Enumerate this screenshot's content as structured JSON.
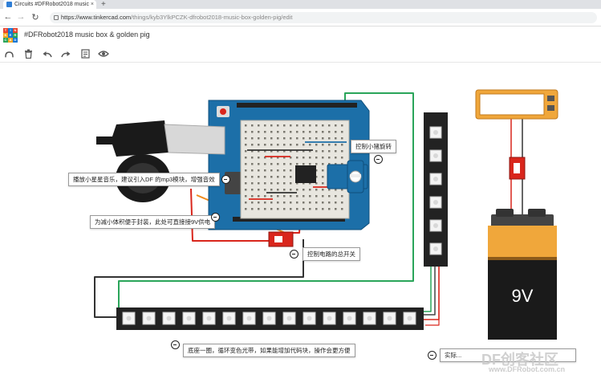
{
  "browser": {
    "tab_title": "Circuits #DFRobot2018 music",
    "tab_close": "×",
    "new_tab": "+",
    "url_main": "https://www.tinkercad.com",
    "url_path": "/things/kyb3YlkPCZK-dfrobot2018-music-box-golden-pig/edit"
  },
  "app": {
    "logo_letters": [
      "T",
      "I",
      "N",
      "K",
      "E",
      "R",
      "C",
      "A",
      "D"
    ],
    "logo_colors": [
      "#e8412c",
      "#1477d4",
      "#e8412c",
      "#f5a623",
      "#1477d4",
      "#2aa55a",
      "#2aa55a",
      "#f5a623",
      "#1477d4"
    ],
    "title": "#DFRobot2018 music box & golden pig"
  },
  "annotations": {
    "music": "播放小星星音乐，建议引入DF 的mp3模块，增强音效",
    "servo": "控制小猪旋转",
    "power": "为减小体积便于封装，此处可直接接9V供电",
    "switch": "控制电路的总开关",
    "base": "底座一圈，循环变色光带，如果能增加代码块，操作会更方便",
    "bottom_right": "实际..."
  },
  "components": {
    "battery_label": "9V",
    "board_label": "DIGITAL (PWM~)"
  },
  "watermark": {
    "brand": "DF创客社区",
    "url": "www.DFRobot.com.cn"
  },
  "colors": {
    "board_blue": "#1c6fa8",
    "battery_orange": "#f0a73b",
    "wire_red": "#d9261c",
    "wire_green": "#2aa55a",
    "wire_orange": "#f08c1e"
  }
}
